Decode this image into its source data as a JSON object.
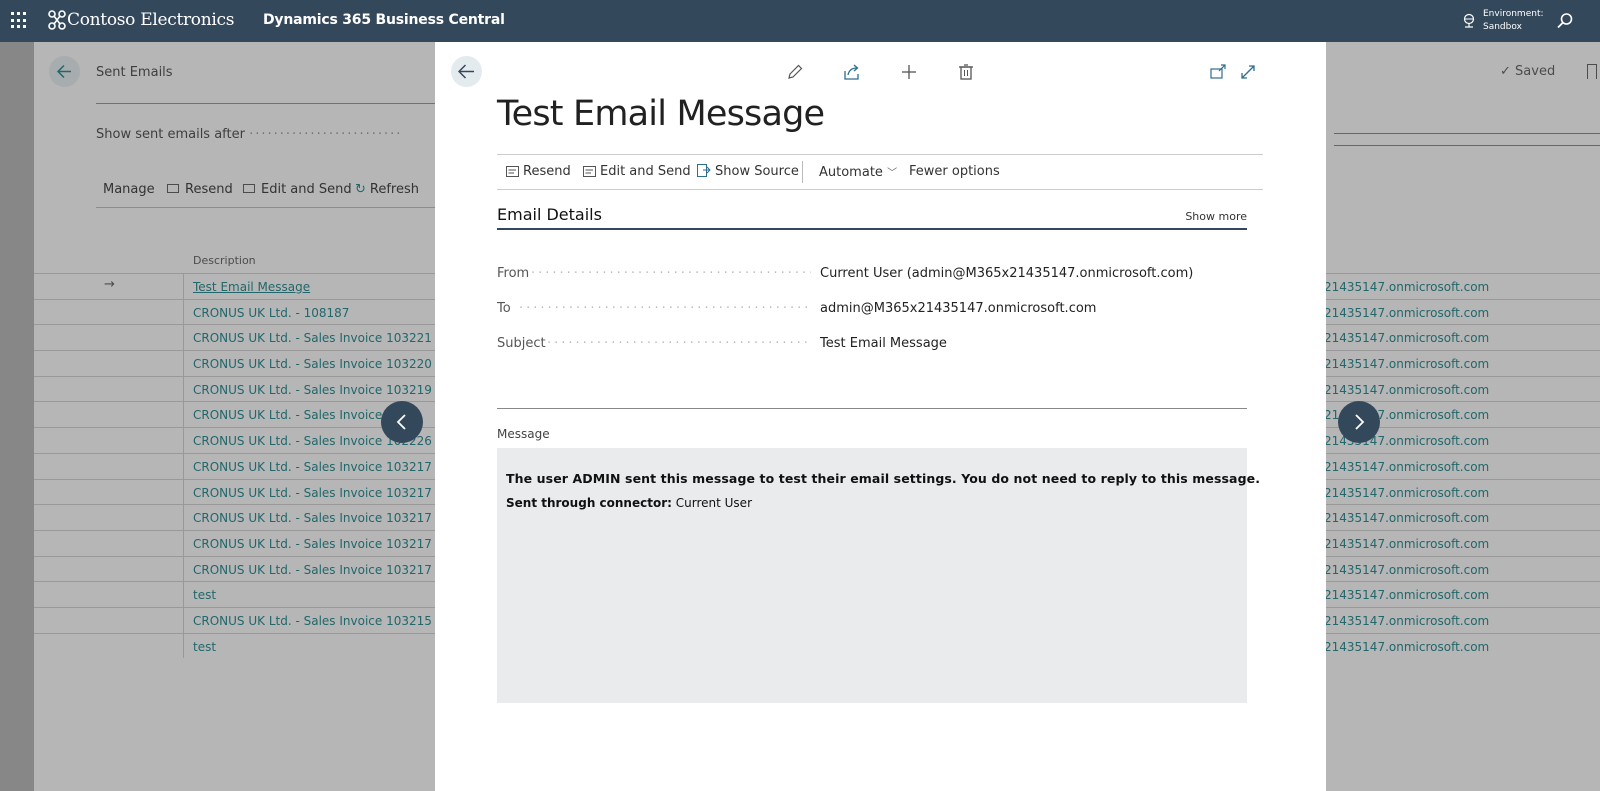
{
  "app": {
    "brand": "Contoso Electronics",
    "product": "Dynamics 365 Business Central",
    "environment_label": "Environment:",
    "environment_value": "Sandbox",
    "topbar_color": "#34485c"
  },
  "background_page": {
    "title": "Sent Emails",
    "filter_label": "Show sent emails after",
    "actions": [
      "Manage",
      "Resend",
      "Edit and Send",
      "Refresh"
    ],
    "saved_label": "Saved",
    "column_description": "Description",
    "rows": [
      {
        "description": "Test Email Message",
        "address": "21435147.onmicrosoft.com"
      },
      {
        "description": "CRONUS UK Ltd. -  108187",
        "address": "21435147.onmicrosoft.com"
      },
      {
        "description": "CRONUS UK Ltd. - Sales Invoice 103221",
        "address": "21435147.onmicrosoft.com"
      },
      {
        "description": "CRONUS UK Ltd. - Sales Invoice 103220",
        "address": "21435147.onmicrosoft.com"
      },
      {
        "description": "CRONUS UK Ltd. - Sales Invoice 103219",
        "address": "21435147.onmicrosoft.com"
      },
      {
        "description": "CRONUS UK Ltd. - Sales Invoice 1",
        "address": "21435147.onmicrosoft.com"
      },
      {
        "description": "CRONUS UK Ltd. - Sales Invoice 102226",
        "address": "21435147.onmicrosoft.com"
      },
      {
        "description": "CRONUS UK Ltd. - Sales Invoice 103217",
        "address": "21435147.onmicrosoft.com"
      },
      {
        "description": "CRONUS UK Ltd. - Sales Invoice 103217",
        "address": "21435147.onmicrosoft.com"
      },
      {
        "description": "CRONUS UK Ltd. - Sales Invoice 103217",
        "address": "21435147.onmicrosoft.com"
      },
      {
        "description": "CRONUS UK Ltd. - Sales Invoice 103217",
        "address": "21435147.onmicrosoft.com"
      },
      {
        "description": "CRONUS UK Ltd. - Sales Invoice 103217",
        "address": "21435147.onmicrosoft.com"
      },
      {
        "description": "test",
        "address": "21435147.onmicrosoft.com"
      },
      {
        "description": "CRONUS UK Ltd. - Sales Invoice 103215",
        "address": "21435147.onmicrosoft.com"
      },
      {
        "description": "test",
        "address": "21435147.onmicrosoft.com"
      }
    ]
  },
  "modal": {
    "title": "Test Email Message",
    "actions": {
      "resend": "Resend",
      "edit_and_send": "Edit and Send",
      "show_source": "Show Source",
      "automate": "Automate",
      "fewer_options": "Fewer options"
    },
    "section_title": "Email Details",
    "show_more": "Show more",
    "fields": {
      "from_label": "From",
      "from_value": "Current User (admin@M365x21435147.onmicrosoft.com)",
      "to_label": "To",
      "to_value": "admin@M365x21435147.onmicrosoft.com",
      "subject_label": "Subject",
      "subject_value": "Test Email Message"
    },
    "message_label": "Message",
    "message_body": "The user ADMIN sent this message to test their email settings. You do not need to reply to this message.",
    "connector_label": "Sent through connector:",
    "connector_value": "Current User"
  }
}
